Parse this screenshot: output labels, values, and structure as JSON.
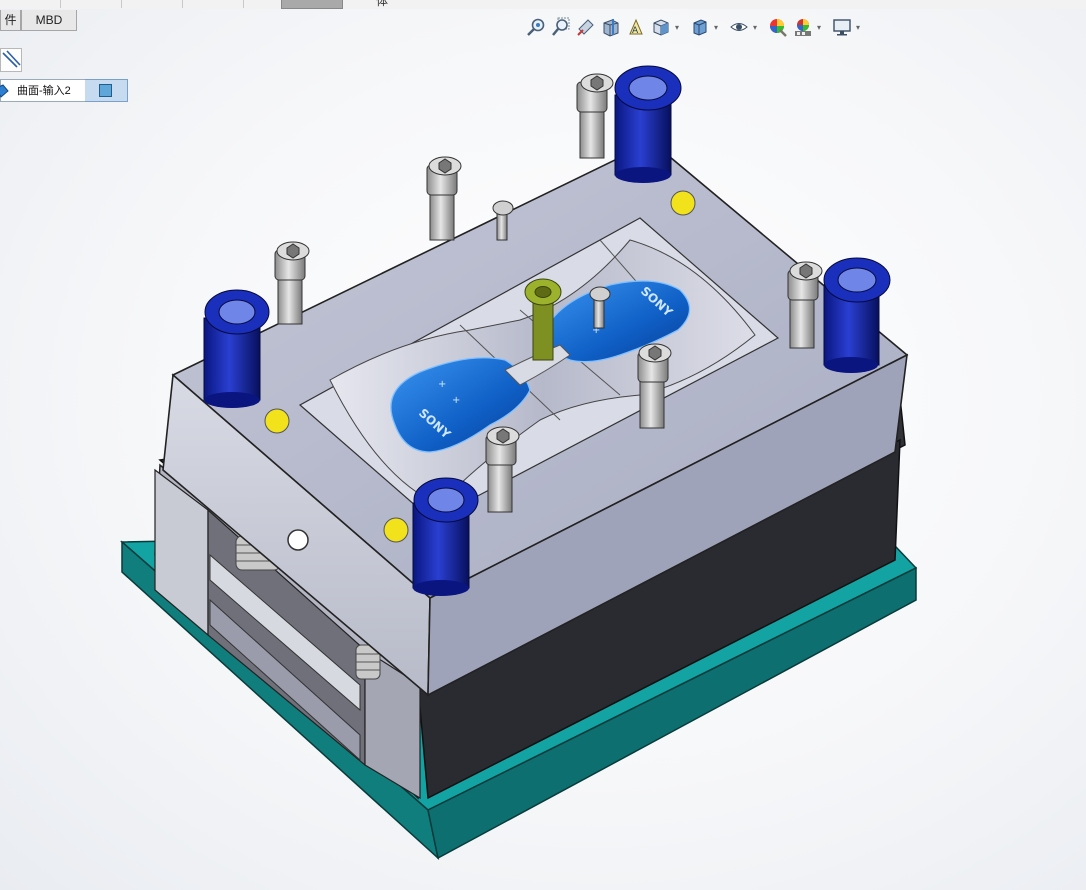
{
  "tabs": {
    "parts_label": "件",
    "mbd_label": "MBD",
    "top_partial_label": "体"
  },
  "heads_up_toolbar": {
    "tools": [
      {
        "icon": "zoom-to-fit-icon"
      },
      {
        "icon": "zoom-to-area-icon"
      },
      {
        "icon": "previous-view-icon"
      },
      {
        "icon": "section-view-icon"
      },
      {
        "icon": "dynamic-annotation-view-icon"
      },
      {
        "icon": "view-orientation-icon",
        "has_menu": true
      },
      {
        "icon": "display-style-icon",
        "has_menu": true
      },
      {
        "icon": "hide-show-items-icon",
        "has_menu": true
      },
      {
        "icon": "edit-appearance-icon"
      },
      {
        "icon": "apply-scene-icon",
        "has_menu": true
      },
      {
        "icon": "view-settings-icon",
        "has_menu": true
      }
    ]
  },
  "breadcrumb": {
    "item_label": "曲面-输入2",
    "item_icon": "surface-feature-icon",
    "end_icon": "body-icon"
  },
  "model": {
    "description_free": true,
    "logo_text_left": "SONY",
    "logo_text_right": "SONY",
    "colors": {
      "plate_top": "#b9bccd",
      "plate_side": "#c9ccd9",
      "plate_dark": "#2e2f34",
      "base_plate": "#168f8f",
      "guide_bushing": "#0d1f9a",
      "part_surface": "#1a6fd4",
      "sprue": "#7f8f1a",
      "ejector_dot": "#f0e01a"
    }
  }
}
